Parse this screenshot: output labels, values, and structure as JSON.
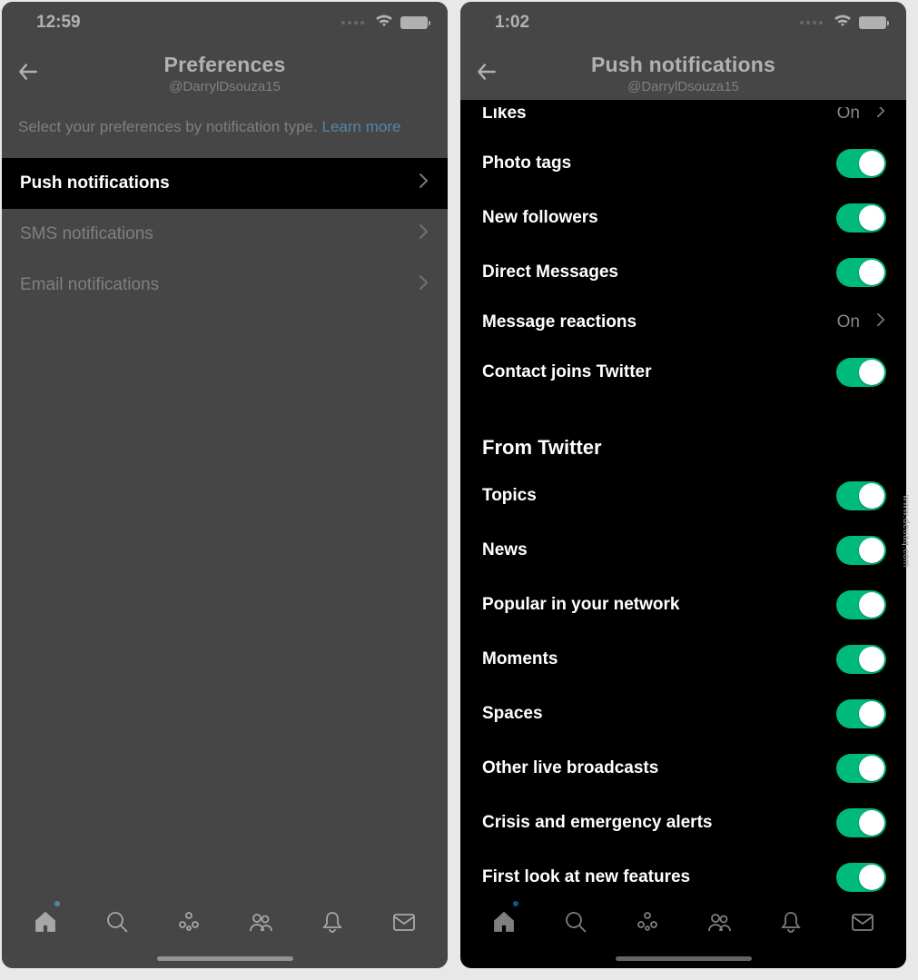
{
  "left": {
    "status": {
      "time": "12:59"
    },
    "header": {
      "title": "Preferences",
      "subtitle": "@DarrylDsouza15"
    },
    "intro": {
      "text": "Select your preferences by notification type. ",
      "learn": "Learn more"
    },
    "rows": [
      {
        "label": "Push notifications"
      },
      {
        "label": "SMS notifications"
      },
      {
        "label": "Email notifications"
      }
    ]
  },
  "right": {
    "status": {
      "time": "1:02"
    },
    "header": {
      "title": "Push notifications",
      "subtitle": "@DarrylDsouza15"
    },
    "cut_row": {
      "label": "Likes",
      "value": "On"
    },
    "section1": [
      {
        "label": "Photo tags",
        "on": true
      },
      {
        "label": "New followers",
        "on": true
      },
      {
        "label": "Direct Messages",
        "on": true
      }
    ],
    "msg_reactions": {
      "label": "Message reactions",
      "value": "On"
    },
    "contact_joins": {
      "label": "Contact joins Twitter",
      "on": true
    },
    "section2_header": "From Twitter",
    "section2": [
      {
        "label": "Topics",
        "on": true
      },
      {
        "label": "News",
        "on": true
      },
      {
        "label": "Popular in your network",
        "on": true
      },
      {
        "label": "Moments",
        "on": true
      },
      {
        "label": "Spaces",
        "on": true
      },
      {
        "label": "Other live broadcasts",
        "on": true
      },
      {
        "label": "Crisis and emergency alerts",
        "on": true
      },
      {
        "label": "First look at new features",
        "on": true
      }
    ]
  },
  "watermark": "www.deuaq.com"
}
